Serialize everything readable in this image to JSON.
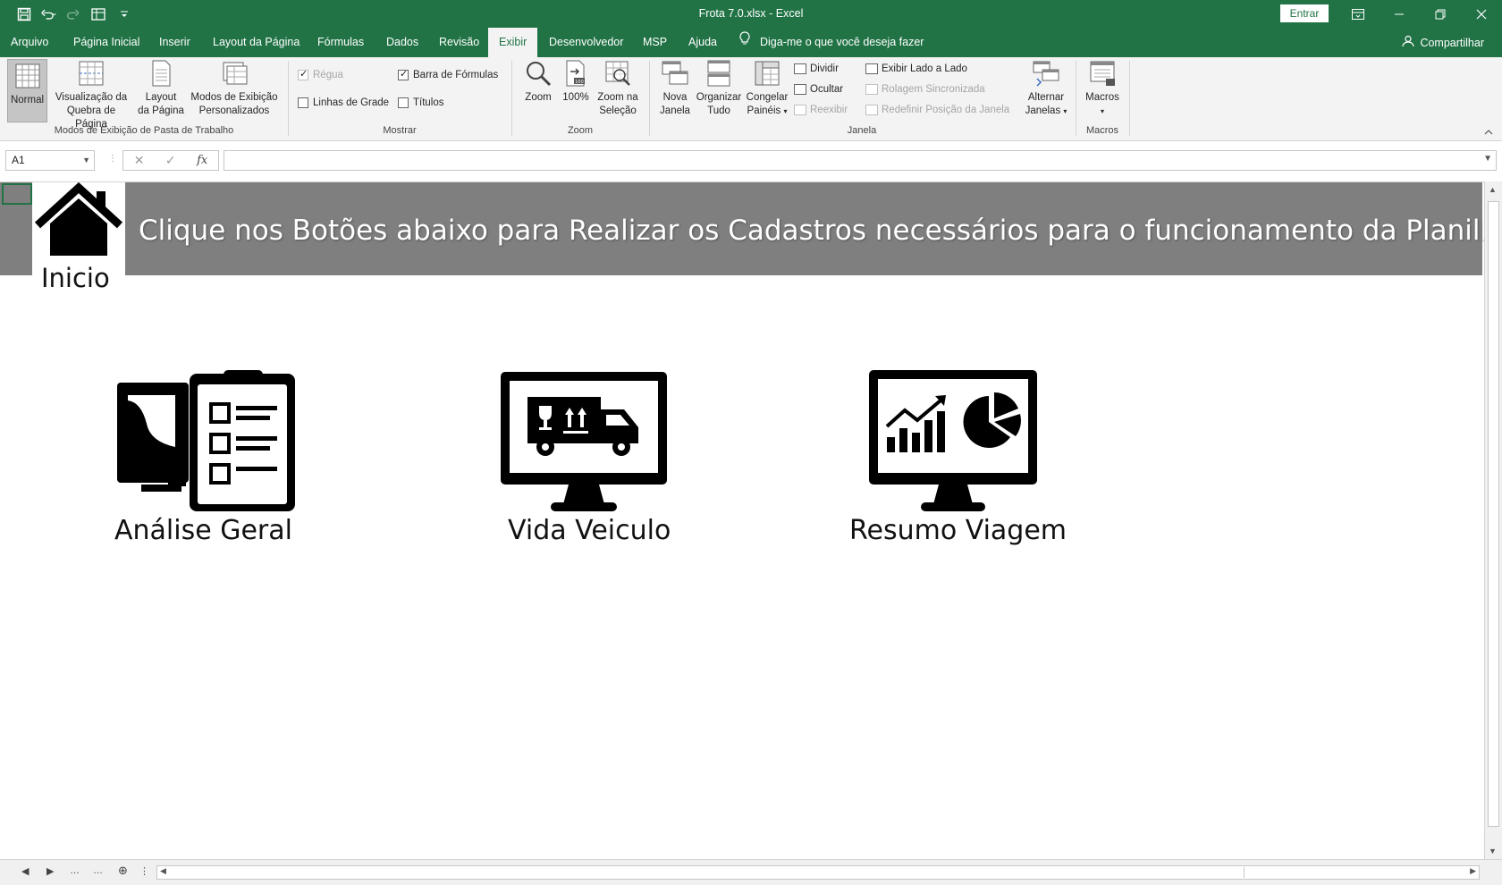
{
  "window": {
    "title": "Frota 7.0.xlsx  -  Excel",
    "signin_label": "Entrar"
  },
  "tabs": [
    {
      "label": "Arquivo"
    },
    {
      "label": "Página Inicial"
    },
    {
      "label": "Inserir"
    },
    {
      "label": "Layout da Página"
    },
    {
      "label": "Fórmulas"
    },
    {
      "label": "Dados"
    },
    {
      "label": "Revisão"
    },
    {
      "label": "Exibir",
      "active": true
    },
    {
      "label": "Desenvolvedor"
    },
    {
      "label": "MSP"
    },
    {
      "label": "Ajuda"
    }
  ],
  "tellme": "Diga-me o que você deseja fazer",
  "share": "Compartilhar",
  "ribbon": {
    "views": {
      "normal": "Normal",
      "page_break_1": "Visualização da",
      "page_break_2": "Quebra de Página",
      "page_layout_1": "Layout",
      "page_layout_2": "da Página",
      "custom_1": "Modos de Exibição",
      "custom_2": "Personalizados",
      "group": "Modos de Exibição de Pasta de Trabalho"
    },
    "show": {
      "ruler": "Régua",
      "formula_bar": "Barra de Fórmulas",
      "gridlines": "Linhas de Grade",
      "headings": "Títulos",
      "group": "Mostrar"
    },
    "zoom": {
      "zoom": "Zoom",
      "hundred": "100%",
      "selection_1": "Zoom na",
      "selection_2": "Seleção",
      "group": "Zoom"
    },
    "window": {
      "new_1": "Nova",
      "new_2": "Janela",
      "arrange_1": "Organizar",
      "arrange_2": "Tudo",
      "freeze_1": "Congelar",
      "freeze_2": "Painéis",
      "split": "Dividir",
      "hide": "Ocultar",
      "unhide": "Reexibir",
      "side_by_side": "Exibir Lado a Lado",
      "sync_scroll": "Rolagem Sincronizada",
      "reset_pos": "Redefinir Posição da Janela",
      "switch_1": "Alternar",
      "switch_2": "Janelas",
      "group": "Janela"
    },
    "macros": {
      "macros": "Macros",
      "group": "Macros"
    }
  },
  "formula_bar": {
    "name_box": "A1",
    "value": ""
  },
  "sheet": {
    "banner": "Clique nos Botões abaixo para Realizar os Cadastros necessários para o funcionamento da Planilha.",
    "home_label": "Inicio",
    "buttons": [
      {
        "label": "Análise Geral",
        "icon": "monitor-clipboard-icon"
      },
      {
        "label": "Vida Veiculo",
        "icon": "monitor-truck-icon"
      },
      {
        "label": "Resumo Viagem",
        "icon": "monitor-chart-icon"
      }
    ]
  },
  "colors": {
    "excel_green": "#217346",
    "banner_gray": "#7f7f7f"
  }
}
